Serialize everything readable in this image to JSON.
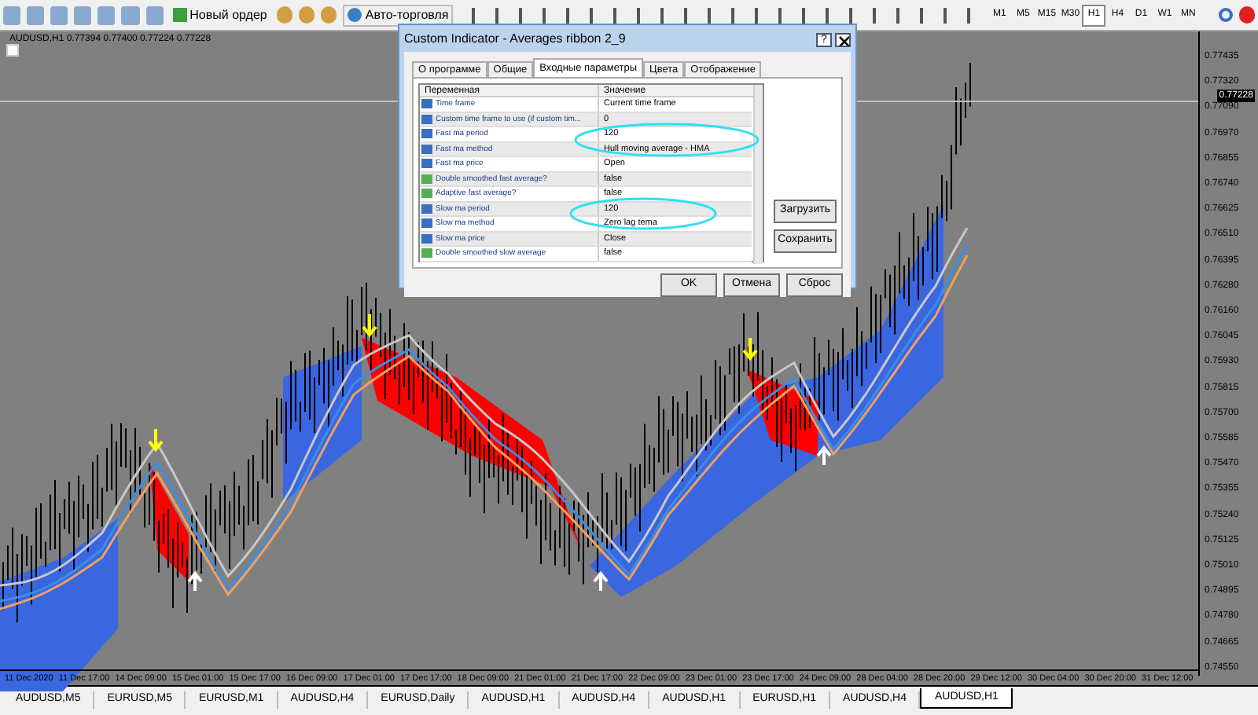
{
  "toolbar": {
    "new_order": "Новый ордер",
    "auto_trading": "Авто-торговля",
    "timeframes": [
      {
        "label": "M1",
        "selected": false
      },
      {
        "label": "M5",
        "selected": false
      },
      {
        "label": "M15",
        "selected": false
      },
      {
        "label": "M30",
        "selected": false
      },
      {
        "label": "H1",
        "selected": true
      },
      {
        "label": "H4",
        "selected": false
      },
      {
        "label": "D1",
        "selected": false
      },
      {
        "label": "W1",
        "selected": false
      },
      {
        "label": "MN",
        "selected": false
      }
    ]
  },
  "chart": {
    "header": "AUDUSD,H1  0.77394 0.77400 0.77224 0.77228",
    "current_price": "0.77228",
    "price_labels": [
      "0.77435",
      "0.77320",
      "0.77090",
      "0.76970",
      "0.76855",
      "0.76740",
      "0.76625",
      "0.76510",
      "0.76395",
      "0.76280",
      "0.76160",
      "0.76045",
      "0.75930",
      "0.75815",
      "0.75700",
      "0.75585",
      "0.75470",
      "0.75355",
      "0.75240",
      "0.75125",
      "0.75010",
      "0.74895",
      "0.74780",
      "0.74665",
      "0.74550"
    ],
    "time_labels": [
      "11 Dec 2020",
      "11 Dec 17:00",
      "14 Dec 09:00",
      "15 Dec 01:00",
      "15 Dec 17:00",
      "16 Dec 09:00",
      "17 Dec 01:00",
      "17 Dec 17:00",
      "18 Dec 09:00",
      "21 Dec 01:00",
      "21 Dec 17:00",
      "22 Dec 09:00",
      "23 Dec 01:00",
      "23 Dec 17:00",
      "24 Dec 09:00",
      "28 Dec 04:00",
      "28 Dec 20:00",
      "29 Dec 12:00",
      "30 Dec 04:00",
      "30 Dec 20:00",
      "31 Dec 12:00"
    ]
  },
  "dialog": {
    "title": "Custom Indicator - Averages ribbon 2_9",
    "help": "?",
    "tabs": [
      {
        "label": "О программе",
        "selected": false
      },
      {
        "label": "Общие",
        "selected": false
      },
      {
        "label": "Входные параметры",
        "selected": true
      },
      {
        "label": "Цвета",
        "selected": false
      },
      {
        "label": "Отображение",
        "selected": false
      }
    ],
    "columns": [
      "Переменная",
      "Значение"
    ],
    "rows": [
      {
        "kind": "enum",
        "name": "Time frame",
        "value": "Current time frame"
      },
      {
        "kind": "enum",
        "name": "Custom time frame to use (if custom tim...",
        "value": "0"
      },
      {
        "kind": "enum",
        "name": "Fast ma period",
        "value": "120"
      },
      {
        "kind": "enum",
        "name": "Fast ma method",
        "value": "Hull moving average - HMA"
      },
      {
        "kind": "enum",
        "name": "Fast ma price",
        "value": "Open"
      },
      {
        "kind": "bool",
        "name": "Double smoothed fast average?",
        "value": "false"
      },
      {
        "kind": "bool",
        "name": "Adaptive fast average?",
        "value": "false"
      },
      {
        "kind": "enum",
        "name": "Slow ma period",
        "value": "120"
      },
      {
        "kind": "enum",
        "name": "Slow ma method",
        "value": "Zero lag tema"
      },
      {
        "kind": "enum",
        "name": "Slow ma price",
        "value": "Close"
      },
      {
        "kind": "bool",
        "name": "Double smoothed slow average",
        "value": "false"
      }
    ],
    "side_buttons": [
      "Загрузить",
      "Сохранить"
    ],
    "buttons": [
      "OK",
      "Отмена",
      "Сброс"
    ]
  },
  "tabs": [
    {
      "label": "AUDUSD,M5",
      "selected": false
    },
    {
      "label": "EURUSD,M5",
      "selected": false
    },
    {
      "label": "EURUSD,M1",
      "selected": false
    },
    {
      "label": "AUDUSD,H4",
      "selected": false
    },
    {
      "label": "EURUSD,Daily",
      "selected": false
    },
    {
      "label": "AUDUSD,H1",
      "selected": false
    },
    {
      "label": "AUDUSD,H4",
      "selected": false
    },
    {
      "label": "AUDUSD,H1",
      "selected": false
    },
    {
      "label": "EURUSD,H1",
      "selected": false
    },
    {
      "label": "AUDUSD,H4",
      "selected": false
    },
    {
      "label": "AUDUSD,H1",
      "selected": true
    }
  ]
}
